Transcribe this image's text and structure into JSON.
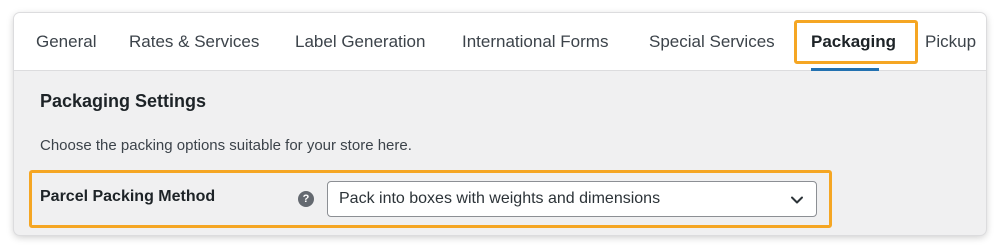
{
  "tabs": [
    {
      "label": "General",
      "active": false
    },
    {
      "label": "Rates & Services",
      "active": false
    },
    {
      "label": "Label Generation",
      "active": false
    },
    {
      "label": "International Forms",
      "active": false
    },
    {
      "label": "Special Services",
      "active": false
    },
    {
      "label": "Packaging",
      "active": true
    },
    {
      "label": "Pickup",
      "active": false
    }
  ],
  "section": {
    "title": "Packaging Settings",
    "description": "Choose the packing options suitable for your store here."
  },
  "packing_method": {
    "label": "Parcel Packing Method",
    "help_icon": "question-circle-icon",
    "help_glyph": "?",
    "selected_value": "Pack into boxes with weights and dimensions"
  },
  "colors": {
    "highlight": "#f5a623",
    "active_tab_underline": "#2271b1",
    "content_background": "#f0f0f1"
  }
}
